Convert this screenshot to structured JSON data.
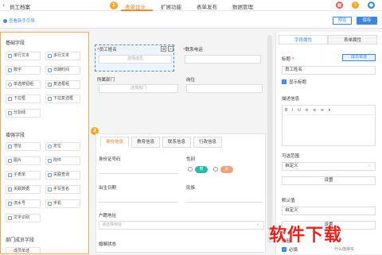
{
  "topbar": {
    "back_glyph": "‹",
    "app_title": "员工档案",
    "badge_1": "1",
    "tabs": [
      "表单设计",
      "扩展功能",
      "表单发布",
      "数据管理"
    ],
    "icons": [
      "grid-icon",
      "help-icon",
      "user-icon"
    ]
  },
  "subbar": {
    "guide_text": "查看新手引导",
    "preview_label": "预览",
    "save_label": "保存"
  },
  "palette": {
    "basic_title": "基础字段",
    "basic_items": [
      "单行文本",
      "多行文本",
      "数字",
      "日期时间",
      "单选按钮组",
      "复选框组",
      "下拉框",
      "下拉复选框",
      "分割线"
    ],
    "advanced_title": "增强字段",
    "advanced_items": [
      "地址",
      "定位",
      "图片",
      "附件",
      "子表单",
      "关联查询",
      "关联数据",
      "手写签名",
      "流水号",
      "手机",
      "文字识别"
    ],
    "dept_title": "部门成员字段",
    "dept_partial": "成员单选"
  },
  "canvas": {
    "badge_2": "2",
    "name_label": "员工姓名",
    "name_placeholder": "选择成员",
    "phone_label": "联系电话",
    "dept_label": "所属部门",
    "dept_placeholder": "选择部门",
    "post_label": "岗位",
    "tabs": [
      "身份信息",
      "教育信息",
      "联系信息",
      "行政信息"
    ],
    "id_label": "身份证号码",
    "gender_label": "性别",
    "gender_options": [
      "男",
      "女"
    ],
    "birth_label": "出生日期",
    "nation_label": "民族",
    "hukou_label": "户籍地址",
    "hukou_placeholder": "请选择地址",
    "marital_label": "婚姻状态"
  },
  "props": {
    "tabs": [
      "字段属性",
      "表单属性"
    ],
    "title_label": "标题",
    "type_tag": "成员单选",
    "title_value": "员工姓名",
    "show_title": "显示标题",
    "desc_label": "描述信息",
    "editor_tools": "B I U ≡ ≡ ≡ ▾",
    "range_label": "可选范围",
    "range_value": "自定义",
    "range_button": "设置",
    "default_label": "默认值",
    "default_value": "自定义",
    "default_button": "设置",
    "validate_label": "校验",
    "required_label": "必填"
  },
  "watermark": {
    "text": "软件下载",
    "sub": "什么值得买"
  },
  "colors": {
    "accent_orange": "#f08a24",
    "primary_blue": "#3b86d8",
    "male_pill": "#2bb8a5",
    "female_pill": "#f4a07a"
  }
}
